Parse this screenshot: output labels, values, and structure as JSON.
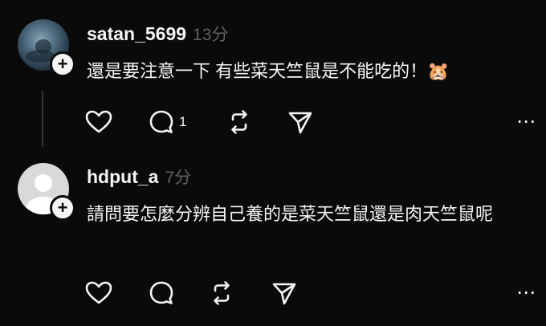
{
  "posts": [
    {
      "username": "satan_5699",
      "time": "13分",
      "text": "還是要注意一下 有些菜天竺鼠是不能吃的！🐹",
      "reply_count": "1",
      "avatar": "photo-avatar"
    },
    {
      "username": "hdput_a",
      "time": "7分",
      "text": "請問要怎麼分辨自己養的是菜天竺鼠還是肉天竺鼠呢",
      "reply_count": "",
      "avatar": "default-avatar"
    }
  ],
  "icons": [
    "plus-icon",
    "heart-icon",
    "comment-icon",
    "repost-icon",
    "share-icon",
    "more-icon"
  ],
  "colors": {
    "background": "#0a0a0a",
    "text": "#f3f5f7",
    "muted": "#616161"
  }
}
